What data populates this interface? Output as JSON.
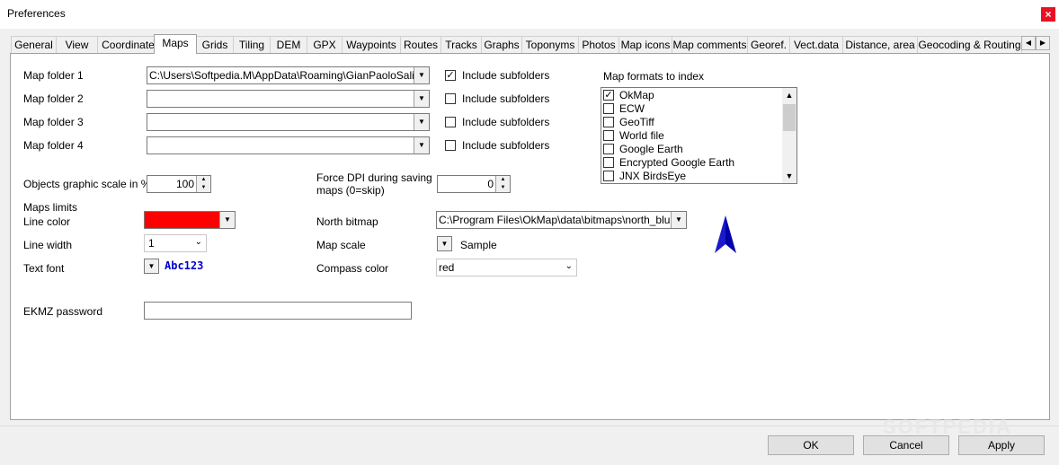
{
  "window": {
    "title": "Preferences",
    "close_glyph": "×"
  },
  "tabs": [
    "General",
    "View",
    "Coordinates",
    "Maps",
    "Grids",
    "Tiling",
    "DEM",
    "GPX",
    "Waypoints",
    "Routes",
    "Tracks",
    "Graphs",
    "Toponyms",
    "Photos",
    "Map icons",
    "Map comments",
    "Georef.",
    "Vect.data",
    "Distance, area",
    "Geocoding & Routing"
  ],
  "active_tab": "Maps",
  "map_folders": [
    {
      "label": "Map folder 1",
      "value": "C:\\Users\\Softpedia.M\\AppData\\Roaming\\GianPaoloSaliola\\O",
      "include_label": "Include subfolders",
      "include_checked": true
    },
    {
      "label": "Map folder 2",
      "value": "",
      "include_label": "Include subfolders",
      "include_checked": false
    },
    {
      "label": "Map folder 3",
      "value": "",
      "include_label": "Include subfolders",
      "include_checked": false
    },
    {
      "label": "Map folder 4",
      "value": "",
      "include_label": "Include subfolders",
      "include_checked": false
    }
  ],
  "formats": {
    "label": "Map formats to index",
    "items": [
      {
        "name": "OkMap",
        "checked": true
      },
      {
        "name": "ECW",
        "checked": false
      },
      {
        "name": "GeoTiff",
        "checked": false
      },
      {
        "name": "World file",
        "checked": false
      },
      {
        "name": "Google Earth",
        "checked": false
      },
      {
        "name": "Encrypted Google Earth",
        "checked": false
      },
      {
        "name": "JNX BirdsEye",
        "checked": false
      }
    ]
  },
  "graphic_scale": {
    "label": "Objects graphic scale in %",
    "value": "100"
  },
  "force_dpi": {
    "label_line1": "Force DPI during saving",
    "label_line2": "maps (0=skip)",
    "value": "0"
  },
  "maps_limits": {
    "heading": "Maps limits",
    "line_color_label": "Line color",
    "line_color": "#ff0000",
    "line_width_label": "Line width",
    "line_width_value": "1",
    "text_font_label": "Text font",
    "text_font_sample": "Abc123"
  },
  "north_bitmap": {
    "label": "North bitmap",
    "value": "C:\\Program Files\\OkMap\\data\\bitmaps\\north_blue.pn"
  },
  "map_scale": {
    "label": "Map scale",
    "sample": "Sample"
  },
  "compass_color": {
    "label": "Compass color",
    "value": "red"
  },
  "ekmz": {
    "label": "EKMZ password",
    "value": ""
  },
  "buttons": {
    "ok": "OK",
    "cancel": "Cancel",
    "apply": "Apply"
  },
  "watermark": "SOFTPEDIA",
  "colors": {
    "accent_blue": "#0000cc",
    "close_red": "#e81123",
    "north_arrow": "#1a1acc"
  }
}
